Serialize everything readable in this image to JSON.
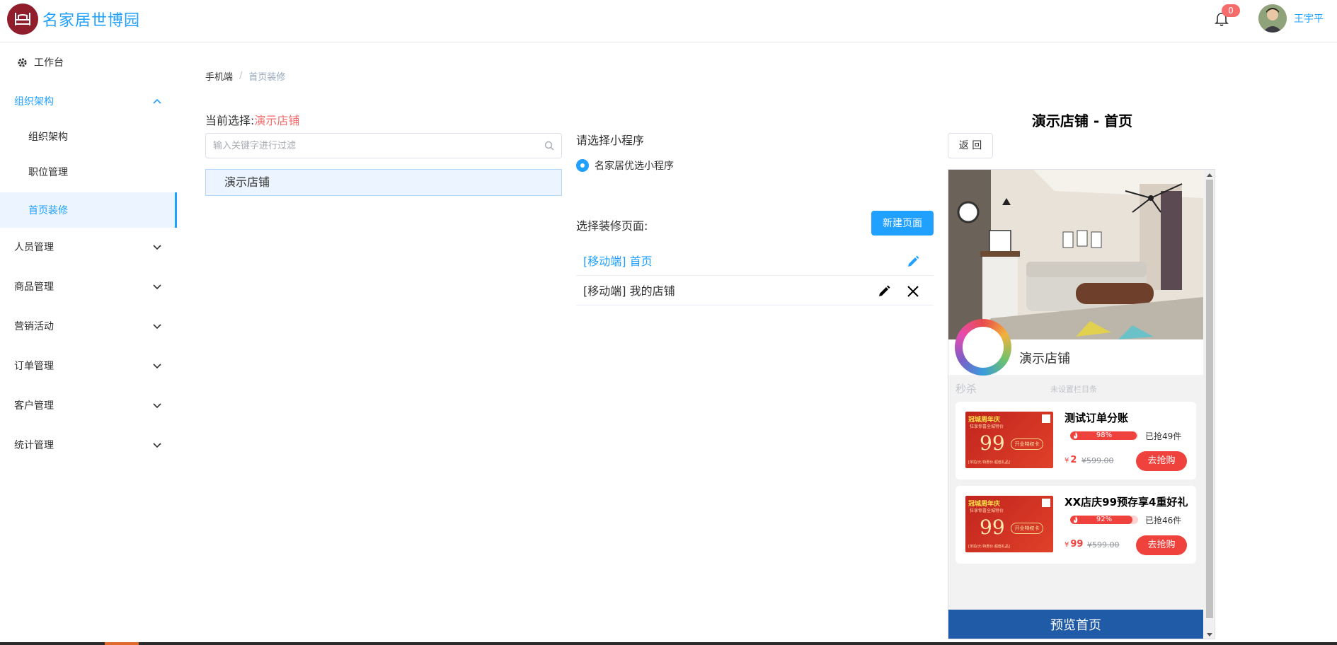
{
  "header": {
    "app_title": "名家居世博园",
    "notification_count": "0",
    "user_name": "王宇平"
  },
  "sidebar": {
    "items": [
      {
        "label": "工作台"
      },
      {
        "label": "组织架构"
      },
      {
        "label": "组织架构"
      },
      {
        "label": "职位管理"
      },
      {
        "label": "首页装修"
      },
      {
        "label": "人员管理"
      },
      {
        "label": "商品管理"
      },
      {
        "label": "营销活动"
      },
      {
        "label": "订单管理"
      },
      {
        "label": "客户管理"
      },
      {
        "label": "统计管理"
      }
    ]
  },
  "breadcrumb": {
    "root": "手机端",
    "separator": "/",
    "current": "首页装修"
  },
  "store_select": {
    "label": "当前选择:",
    "value": "演示店铺",
    "filter_placeholder": "输入关键字进行过滤",
    "stores": [
      "演示店铺"
    ]
  },
  "mini_program": {
    "title": "请选择小程序",
    "option": "名家居优选小程序"
  },
  "decoration": {
    "title": "选择装修页面:",
    "new_page_label": "新建页面",
    "pages": [
      {
        "label": "[移动端] 首页"
      },
      {
        "label": "[移动端] 我的店铺"
      }
    ]
  },
  "preview": {
    "title": "演示店铺 - 首页",
    "back_label": "返 回",
    "store_name": "演示店铺",
    "seckill_label": "秒杀",
    "seckill_sub": "未设置栏目条",
    "products": [
      {
        "name": "测试订单分账",
        "progress_label": "98%",
        "progress": 0.98,
        "sold": "已抢49件",
        "currency": "¥",
        "price": "2",
        "old_price": "¥599.00",
        "buy_label": "去抢购",
        "image_text": {
          "headline": "冠城周年庆",
          "sub": "狂享惊喜全城特价",
          "big": "99",
          "pill": "开业特权卡",
          "footer": "[单拍/元·特惠价·超值礼品]"
        }
      },
      {
        "name": "XX店庆99预存享4重好礼",
        "progress_label": "92%",
        "progress": 0.92,
        "sold": "已抢46件",
        "currency": "¥",
        "price": "99",
        "old_price": "¥599.00",
        "buy_label": "去抢购",
        "image_text": {
          "headline": "冠城周年庆",
          "sub": "狂享惊喜全城特价",
          "big": "99",
          "pill": "开业特权卡",
          "footer": "[单拍/元·特惠价·超值礼品]"
        }
      }
    ],
    "preview_button": "预览首页"
  },
  "colors": {
    "primary": "#20a0ff",
    "danger": "#f56c6c",
    "logo_bg": "#8f1d2c",
    "preview_button_bg": "#1f5ba6",
    "buy_button_bg": "#f0423d"
  },
  "icons": {
    "logo": "bed-icon",
    "notification": "bell-icon",
    "workbench": "gear-icon",
    "expand": "chevron-down-icon",
    "collapse": "chevron-up-icon",
    "search": "search-icon",
    "edit": "pencil-icon",
    "delete": "close-icon"
  }
}
